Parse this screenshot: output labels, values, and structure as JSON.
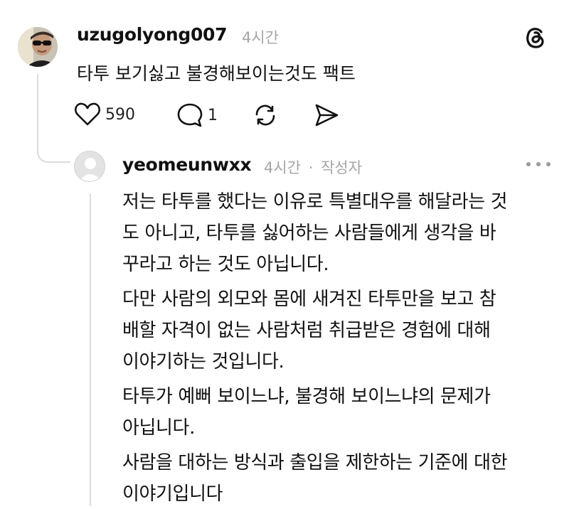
{
  "post": {
    "username": "uzugolyong007",
    "time": "4시간",
    "text": "타투 보기싫고 불경해보이는것도 팩트",
    "likes": "590",
    "comments": "1",
    "icons": {
      "like": "heart-icon",
      "comment": "comment-bubble-icon",
      "repost": "repost-icon",
      "share": "send-icon",
      "app": "threads-logo-icon"
    }
  },
  "reply": {
    "username": "yeomeunwxx",
    "time": "4시간",
    "separator": "·",
    "author_badge": "작성자",
    "paragraphs": [
      [
        "저는 타투를 했다는 이유로 특별대우를 해달라는 것",
        "도 아니고, 타투를 싫어하는 사람들에게 생각을 바",
        "꾸라고 하는 것도 아닙니다."
      ],
      [
        "다만 사람의 외모와 몸에 새겨진 타투만을 보고 참",
        "배할 자격이 없는 사람처럼 취급받은 경험에 대해",
        "이야기하는 것입니다."
      ],
      [
        "타투가 예뻐 보이느냐, 불경해 보이느냐의 문제가",
        "아닙니다."
      ],
      [
        "사람을 대하는 방식과 출입을 제한하는 기준에 대한",
        "이야기입니다"
      ]
    ]
  },
  "colors": {
    "text": "#111111",
    "meta": "#a6a6a6",
    "thread_line": "#dcdcdc",
    "background": "#ffffff"
  }
}
